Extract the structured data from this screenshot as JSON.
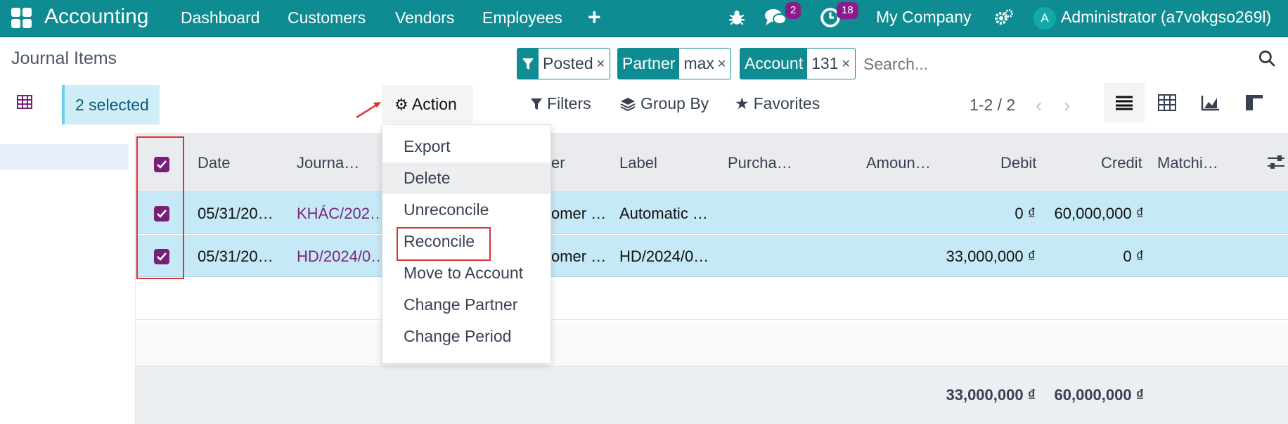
{
  "topbar": {
    "app_title": "Accounting",
    "nav": [
      "Dashboard",
      "Customers",
      "Vendors",
      "Employees"
    ],
    "messages_badge": "2",
    "activities_badge": "18",
    "company": "My Company",
    "avatar_letter": "A",
    "user": "Administrator (a7vokgso269l)"
  },
  "control": {
    "page_title": "Journal Items",
    "facets": [
      {
        "label": "Posted",
        "value": ""
      },
      {
        "label": "Partner",
        "value": "max"
      },
      {
        "label": "Account",
        "value": "131"
      }
    ],
    "search_placeholder": "Search...",
    "selected": "2 selected",
    "action": "Action",
    "filters": "Filters",
    "group_by": "Group By",
    "favorites": "Favorites",
    "pager": "1-2 / 2"
  },
  "action_menu": [
    "Export",
    "Delete",
    "Unreconcile",
    "Reconcile",
    "Move to Account",
    "Change Partner",
    "Change Period"
  ],
  "table": {
    "headers": [
      "Date",
      "Journa…",
      "er",
      "Label",
      "Purcha…",
      "Amoun…",
      "Debit",
      "Credit",
      "Matchi…"
    ],
    "rows": [
      {
        "date": "05/31/20…",
        "journal": "KHÁC/202…",
        "partner": "omer …",
        "label": "Automatic …",
        "debit": "0 ₫",
        "credit": "60,000,000 ₫"
      },
      {
        "date": "05/31/20…",
        "journal": "HD/2024/0…",
        "partner": "omer …",
        "label": "HD/2024/0…",
        "debit": "33,000,000 ₫",
        "credit": "0 ₫"
      }
    ],
    "totals": {
      "debit": "33,000,000 ₫",
      "credit": "60,000,000 ₫"
    }
  },
  "colors": {
    "brand": "#0f8c91",
    "checkbox": "#7a1f77",
    "row_selected": "#c6e9f7",
    "highlight": "#e03131"
  }
}
